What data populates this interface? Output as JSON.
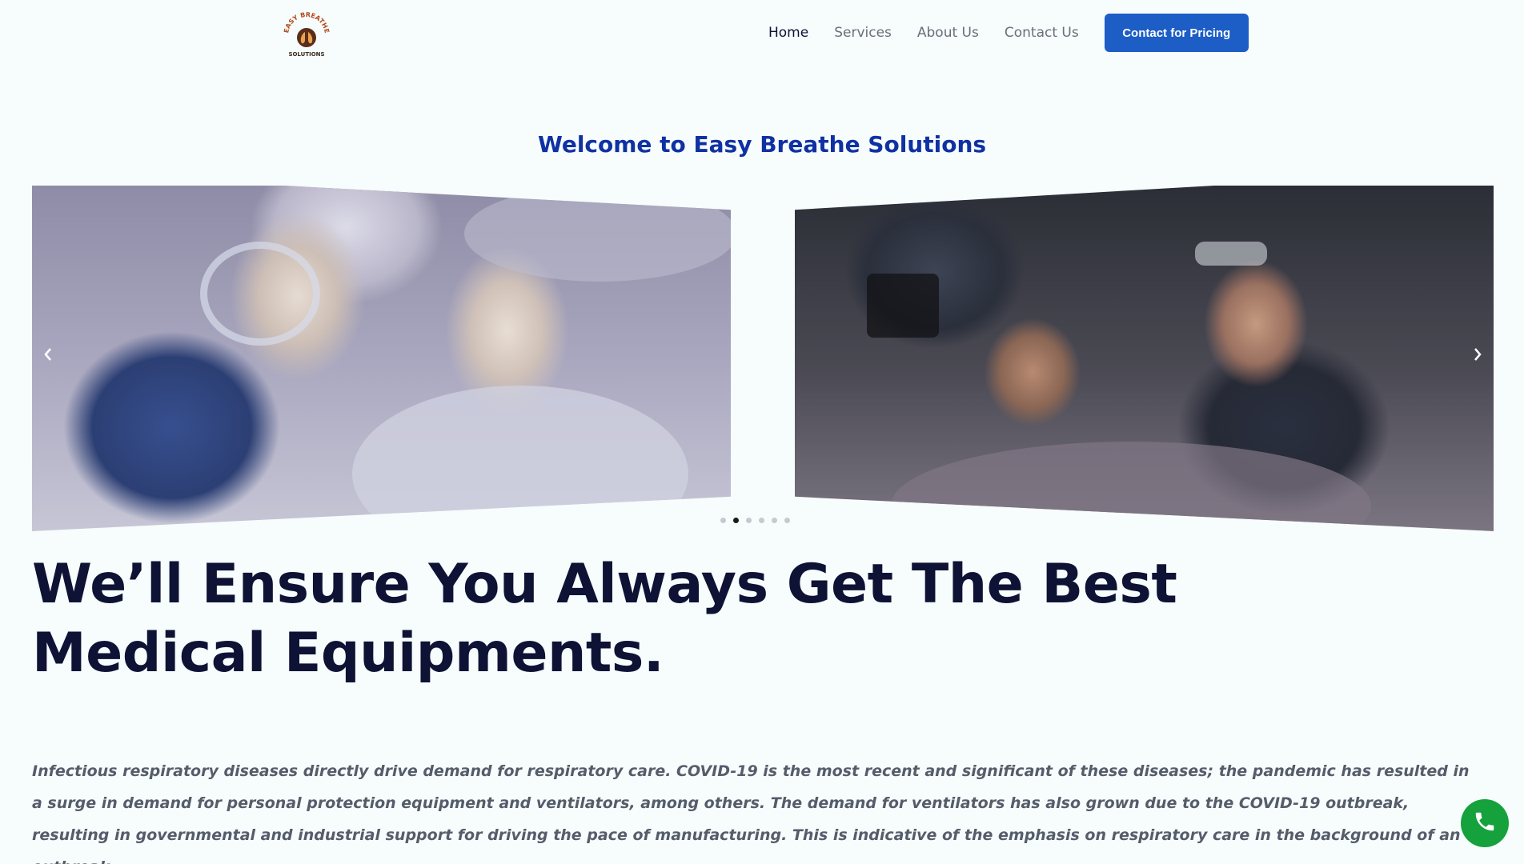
{
  "brand": {
    "logo_text_top": "EASY BREATHE",
    "logo_text_bottom": "SOLUTIONS",
    "logo_icon": "lungs-icon",
    "accent": "#1d5dc6",
    "title_color": "#0f31a3",
    "phone_color": "#15a13b"
  },
  "nav": {
    "items": [
      {
        "label": "Home",
        "active": true
      },
      {
        "label": "Services",
        "active": false
      },
      {
        "label": "About Us",
        "active": false
      },
      {
        "label": "Contact Us",
        "active": false
      }
    ],
    "cta_label": "Contact for Pricing"
  },
  "welcome": "Welcome to Easy Breathe Solutions",
  "carousel": {
    "slides": [
      {
        "description_icon": "cpap-couple-sleeping-image"
      },
      {
        "description_icon": "cpap-man-phone-bed-image"
      }
    ],
    "prev_icon": "chevron-left-icon",
    "next_icon": "chevron-right-icon",
    "dot_count": 6,
    "active_dot": 2
  },
  "headline": "We’ll Ensure You Always Get The Best Medical Equipments.",
  "intro": "Infectious respiratory diseases directly drive demand for respiratory care. COVID-19 is the most recent and significant of these diseases; the pandemic has resulted in a surge in demand for personal protection equipment and ventilators, among others. The demand for ventilators has also grown due to the COVID-19 outbreak, resulting in governmental and industrial support for driving the pace of manufacturing. This is indicative of the emphasis on respiratory care in the background of an outbreak.",
  "fab_icon": "phone-icon"
}
